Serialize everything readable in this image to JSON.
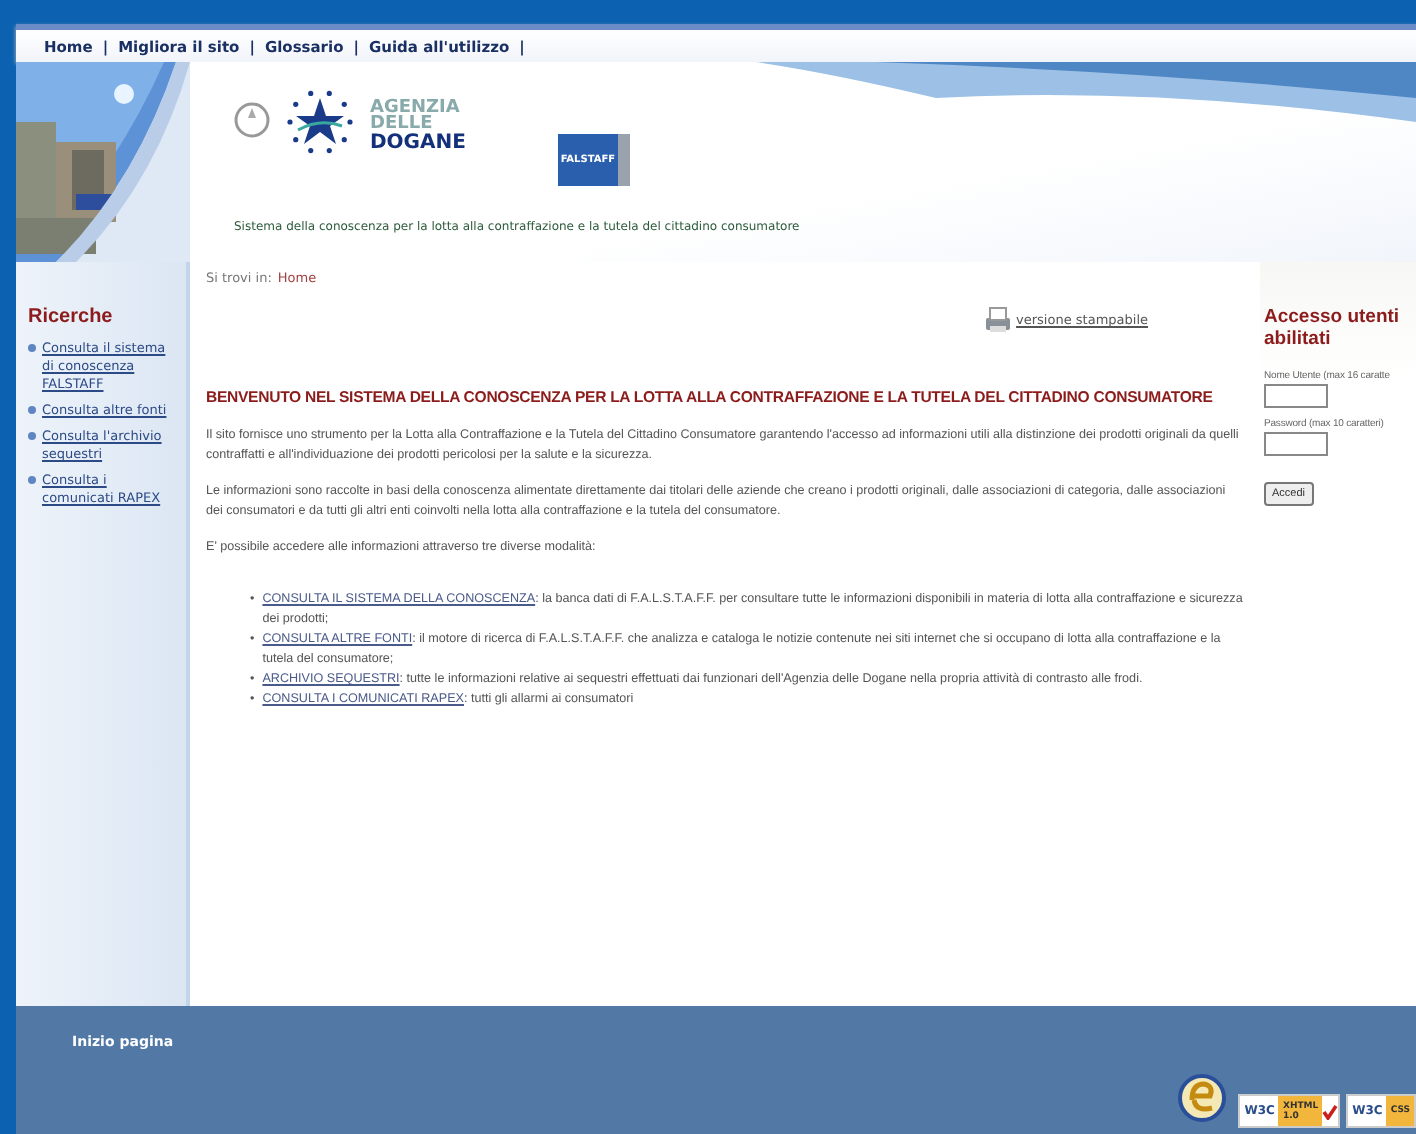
{
  "nav": [
    {
      "label": "Home",
      "separator": "|"
    },
    {
      "label": "Migliora il sito",
      "separator": "|"
    },
    {
      "label": "Glossario",
      "separator": "|"
    },
    {
      "label": "Guida all'utilizzo",
      "separator": "|"
    }
  ],
  "header": {
    "agency_lines": [
      "AGENZIA",
      "DELLE",
      "DOGANE"
    ],
    "project_logo": "FALSTAFF",
    "tagline": "Sistema della conoscenza per la lotta alla contraffazione e la tutela del cittadino consumatore"
  },
  "breadcrumb": {
    "prefix": "Si trovi in:",
    "current": "Home"
  },
  "sidebar": {
    "title": "Ricerche",
    "items": [
      {
        "label": "Consulta il sistema di conoscenza FALSTAFF"
      },
      {
        "label": "Consulta altre fonti"
      },
      {
        "label": "Consulta l'archivio sequestri"
      },
      {
        "label": "Consulta i comunicati RAPEX"
      }
    ]
  },
  "print_link": "versione stampabile",
  "title": "BENVENUTO NEL SISTEMA DELLA CONOSCENZA PER LA LOTTA ALLA CONTRAFFAZIONE E LA TUTELA DEL CITTADINO CONSUMATORE",
  "paragraphs": [
    "Il sito fornisce uno strumento per la Lotta alla Contraffazione e la Tutela del Cittadino Consumatore garantendo l'accesso ad informazioni utili alla distinzione dei prodotti originali da quelli contraffatti e all'individuazione dei prodotti pericolosi per la salute e la sicurezza.",
    "Le informazioni sono raccolte in basi della conoscenza alimentate direttamente dai titolari delle aziende che creano i prodotti originali, dalle associazioni di categoria, dalle associazioni dei consumatori e da tutti gli altri enti coinvolti nella lotta alla contraffazione e la tutela del consumatore.",
    "E' possibile accedere alle informazioni attraverso tre diverse modalità:"
  ],
  "modes": [
    {
      "bullet": "•",
      "link": "CONSULTA IL SISTEMA DELLA CONOSCENZA",
      "text": ": la banca dati di F.A.L.S.T.A.F.F. per consultare tutte le informazioni disponibili in materia di lotta alla contraffazione e sicurezza dei prodotti;"
    },
    {
      "bullet": "•",
      "link": "CONSULTA ALTRE FONTI",
      "text": ": il motore di ricerca di F.A.L.S.T.A.F.F. che analizza e cataloga le notizie contenute nei siti internet che si occupano di lotta alla contraffazione e la tutela del consumatore;"
    },
    {
      "bullet": "•",
      "link": "ARCHIVIO SEQUESTRI",
      "text": ": tutte le informazioni relative ai sequestri effettuati dai funzionari dell'Agenzia delle Dogane nella propria attività di contrasto alle frodi."
    },
    {
      "bullet": "•",
      "link": "CONSULTA I COMUNICATI RAPEX",
      "text": ": tutti gli allarmi ai consumatori"
    }
  ],
  "login": {
    "title": "Accesso utenti abilitati",
    "fields": [
      {
        "label": "Nome Utente (max 16 caratte"
      },
      {
        "label": "Password (max 10 caratteri)"
      }
    ],
    "button": "Accedi"
  },
  "footer": {
    "top_link": "Inizio pagina",
    "badges": [
      {
        "kind": "xhtml",
        "org": "W3C",
        "lines": [
          "XHTML",
          "1.0"
        ]
      },
      {
        "kind": "css",
        "org": "W3C",
        "lines": [
          "CSS"
        ]
      }
    ]
  }
}
